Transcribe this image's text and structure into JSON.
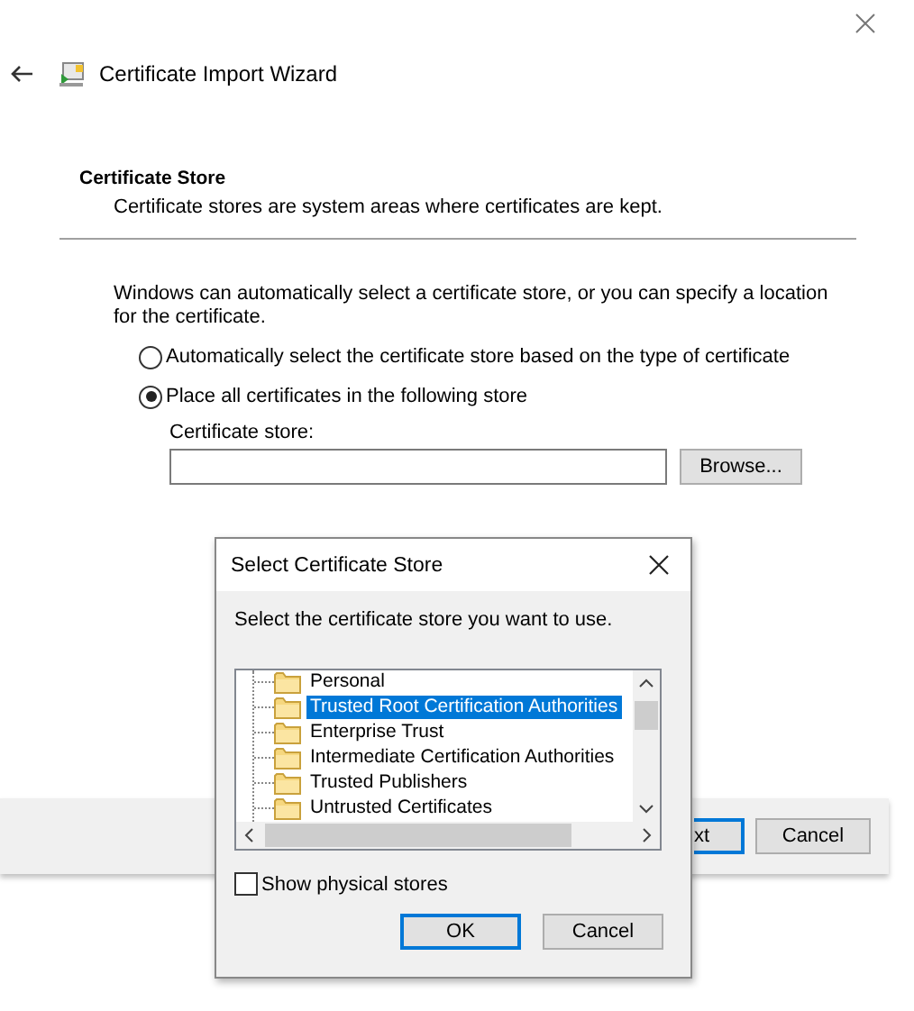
{
  "window": {
    "title": "Certificate Import Wizard"
  },
  "section": {
    "heading": "Certificate Store",
    "description": "Certificate stores are system areas where certificates are kept."
  },
  "intro": "Windows can automatically select a certificate store, or you can specify a location for the certificate.",
  "options": [
    {
      "label": "Automatically select the certificate store based on the type of certificate",
      "selected": false
    },
    {
      "label": "Place all certificates in the following store",
      "selected": true
    }
  ],
  "store_field": {
    "label": "Certificate store:"
  },
  "browse_button": "Browse...",
  "footer_buttons": [
    {
      "label": "xt",
      "covered": true
    },
    {
      "label": "Cancel",
      "covered": false
    }
  ],
  "dialog": {
    "title": "Select Certificate Store",
    "prompt": "Select the certificate store you want to use.",
    "stores": [
      {
        "label": "Personal",
        "selected": false
      },
      {
        "label": "Trusted Root Certification Authorities",
        "selected": true
      },
      {
        "label": "Enterprise Trust",
        "selected": false
      },
      {
        "label": "Intermediate Certification Authorities",
        "selected": false
      },
      {
        "label": "Trusted Publishers",
        "selected": false
      },
      {
        "label": "Untrusted Certificates",
        "selected": false
      }
    ],
    "show_physical_stores": {
      "label": "Show physical stores",
      "checked": false
    },
    "buttons": [
      {
        "label": "OK",
        "default": true
      },
      {
        "label": "Cancel",
        "default": false
      }
    ]
  }
}
